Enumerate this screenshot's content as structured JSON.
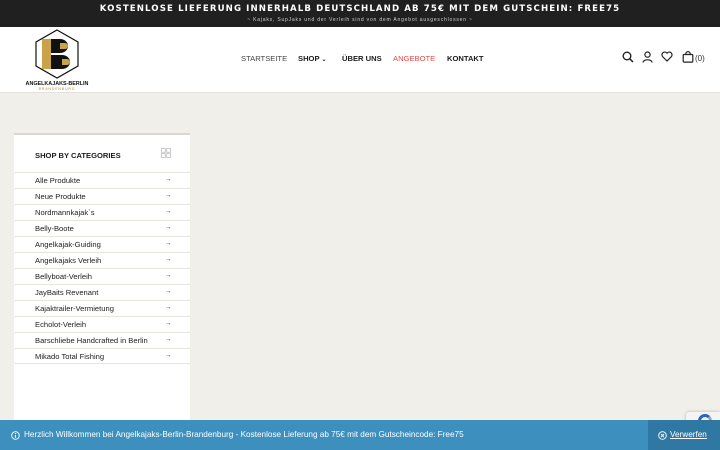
{
  "topbar": {
    "headline": "KOSTENLOSE LIEFERUNG INNERHALB DEUTSCHLAND AB 75€ MIT DEM GUTSCHEIN: FREE75",
    "subline": "~ Kajaks, SupJaks und der Verleih sind von dem Angebot ausgeschlossen ~"
  },
  "logo": {
    "brand": "ANGELKAJAKS-BERLIN",
    "sub": "BRANDENBURG",
    "colors": {
      "gold": "#c9a24a",
      "dark": "#111111"
    }
  },
  "nav": {
    "items": [
      {
        "label": "STARTSEITE"
      },
      {
        "label": "SHOP",
        "has_dropdown": true
      },
      {
        "label": "ÜBER UNS"
      },
      {
        "label": "ANGEBOTE",
        "color": "#e24a4a"
      },
      {
        "label": "KONTAKT"
      }
    ]
  },
  "header_icons": {
    "search": "search-icon",
    "account": "user-icon",
    "wishlist": "heart-icon",
    "cart": "cart-icon",
    "cart_count": "(0)"
  },
  "sidebar": {
    "title": "SHOP BY CATEGORIES",
    "categories": [
      "Alle Produkte",
      "Neue Produkte",
      "Nordmannkajak`s",
      "Belly-Boote",
      "Angelkajak-Guiding",
      "Angelkajaks Verleih",
      "Bellyboat-Verleih",
      "JayBaits Revenant",
      "Kajaktrailer-Vermietung",
      "Echolot-Verleih",
      "Barschliebe Handcrafted in Berlin",
      "Mikado Total Fishing"
    ],
    "arrow_glyph": "→"
  },
  "notice": {
    "message": "Herzlich Willkommen bei Angelkajaks-Berlin-Brandenburg - Kostenlose Lieferung ab 75€ mit dem Gutscheincode: Free75",
    "dismiss_label": "Verwerfen",
    "background": "#3d8fbe"
  }
}
